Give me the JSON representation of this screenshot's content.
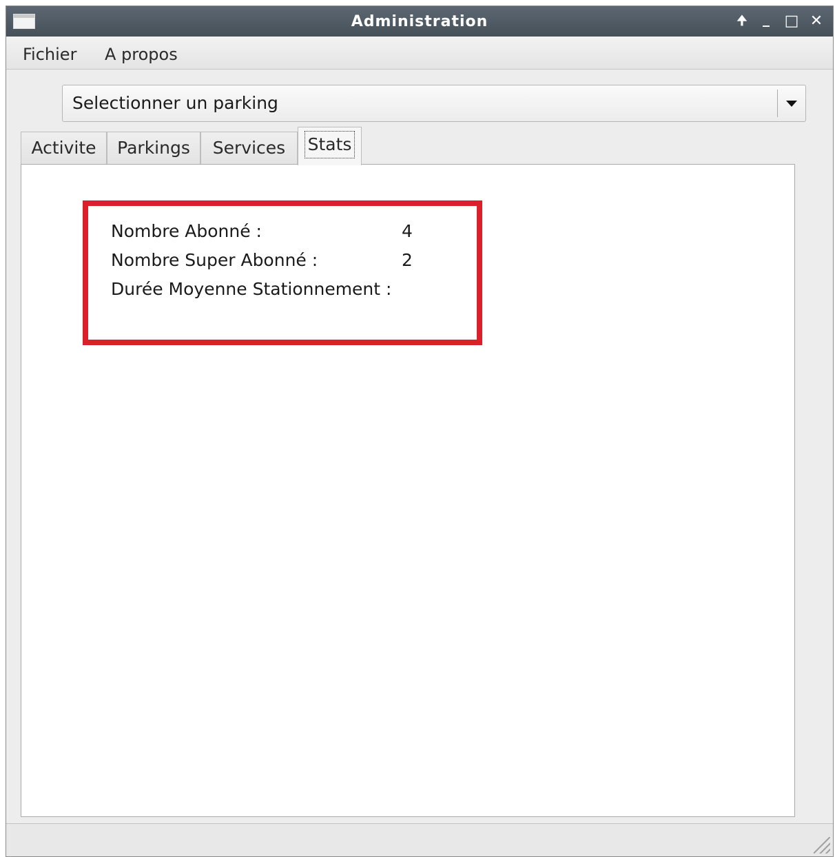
{
  "window": {
    "title": "Administration",
    "controls": {
      "up_glyph": "🠉",
      "minimize_glyph": "_",
      "maximize_glyph": "□",
      "close_glyph": "✕"
    }
  },
  "menubar": {
    "items": [
      {
        "label": "Fichier"
      },
      {
        "label": "A propos"
      }
    ]
  },
  "parking_select": {
    "value": "Selectionner un parking"
  },
  "tabs": [
    {
      "label": "Activite",
      "active": false
    },
    {
      "label": "Parkings",
      "active": false
    },
    {
      "label": "Services",
      "active": false
    },
    {
      "label": "Stats",
      "active": true
    }
  ],
  "stats": {
    "rows": [
      {
        "label": "Nombre Abonné :",
        "value": "4"
      },
      {
        "label": "Nombre Super Abonné :",
        "value": "2"
      },
      {
        "label": "Durée Moyenne Stationnement :",
        "value": ""
      }
    ]
  },
  "colors": {
    "highlight_border": "#d9202b",
    "titlebar": "#4f5962"
  },
  "icons": {
    "window_icon": "app-window-icon",
    "combo_arrow": "chevron-down-icon",
    "resize_grip": "resize-grip-icon"
  }
}
